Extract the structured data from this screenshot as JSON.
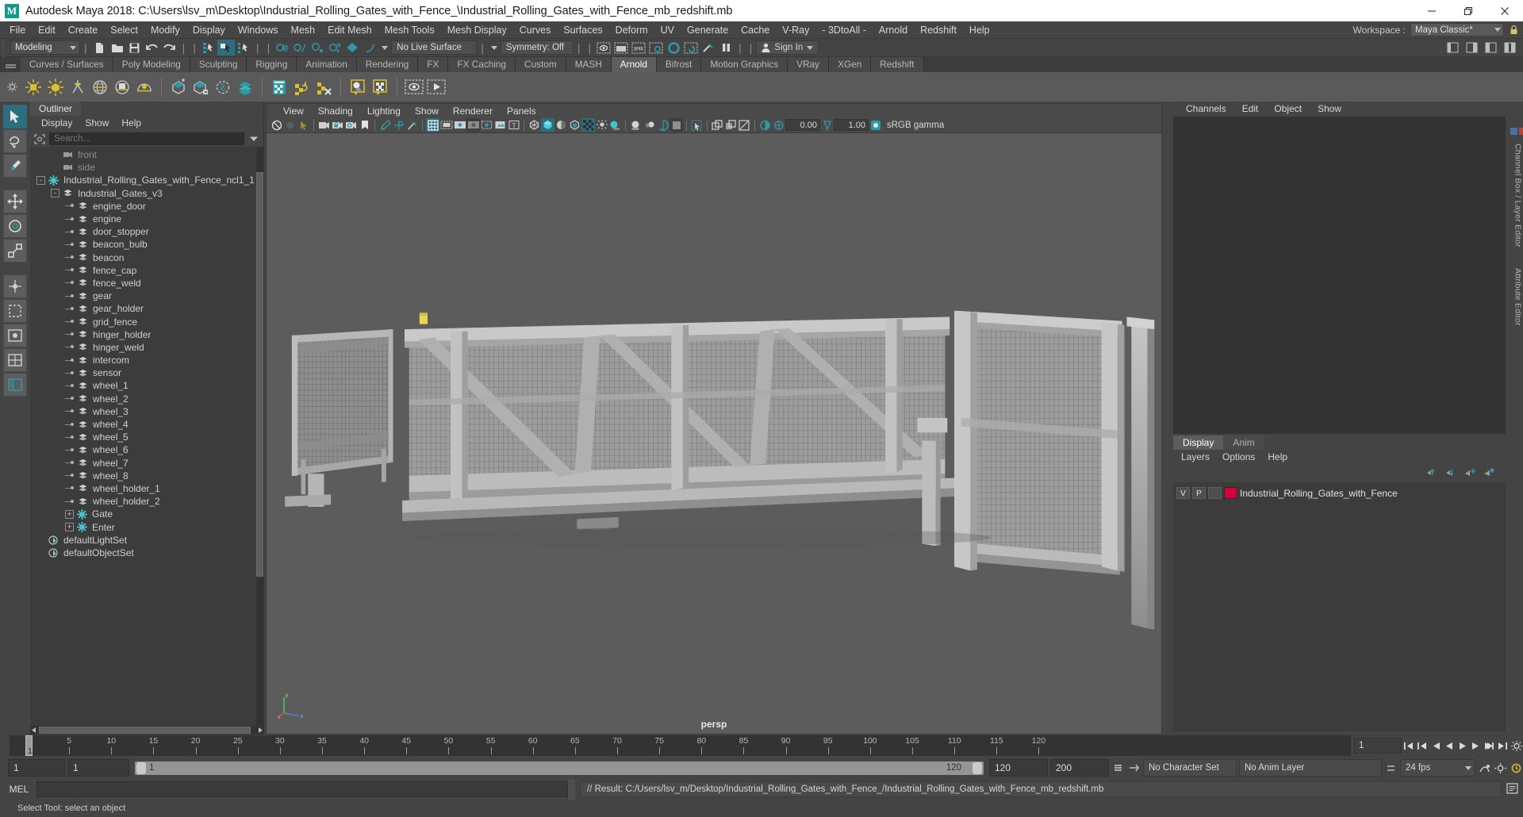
{
  "window": {
    "title": "Autodesk Maya 2018: C:\\Users\\lsv_m\\Desktop\\Industrial_Rolling_Gates_with_Fence_\\Industrial_Rolling_Gates_with_Fence_mb_redshift.mb",
    "logo": "M",
    "minimize": "minimize-icon",
    "restore": "restore-icon",
    "close": "close-icon"
  },
  "menubar": {
    "items": [
      "File",
      "Edit",
      "Create",
      "Select",
      "Modify",
      "Display",
      "Windows",
      "Mesh",
      "Edit Mesh",
      "Mesh Tools",
      "Mesh Display",
      "Curves",
      "Surfaces",
      "Deform",
      "UV",
      "Generate",
      "Cache",
      "V-Ray",
      "- 3DtoAll -",
      "Arnold",
      "Redshift",
      "Help"
    ],
    "workspace_label": "Workspace :",
    "workspace_value": "Maya Classic*"
  },
  "statusline": {
    "mode": "Modeling",
    "live_surface": "No Live Surface",
    "symmetry": "Symmetry: Off",
    "signin": "Sign In"
  },
  "shelf": {
    "tabs": [
      "Curves / Surfaces",
      "Poly Modeling",
      "Sculpting",
      "Rigging",
      "Animation",
      "Rendering",
      "FX",
      "FX Caching",
      "Custom",
      "MASH",
      "Arnold",
      "Bifrost",
      "Motion Graphics",
      "VRay",
      "XGen",
      "Redshift"
    ],
    "active_tab": "Arnold"
  },
  "outliner": {
    "tab": "Outliner",
    "menus": [
      "Display",
      "Show",
      "Help"
    ],
    "search_placeholder": "Search...",
    "items": [
      {
        "label": "front",
        "depth": 2,
        "icon": "camera-icon",
        "dim": true,
        "expander": null
      },
      {
        "label": "side",
        "depth": 2,
        "icon": "camera-icon",
        "dim": true,
        "expander": null
      },
      {
        "label": "Industrial_Rolling_Gates_with_Fence_ncl1_1",
        "depth": 1,
        "icon": "transform-icon",
        "dim": false,
        "expander": "-"
      },
      {
        "label": "Industrial_Gates_v3",
        "depth": 2,
        "icon": "mesh-icon",
        "dim": false,
        "expander": "-"
      },
      {
        "label": "engine_door",
        "depth": 3,
        "icon": "mesh-icon",
        "dim": false,
        "expander": null
      },
      {
        "label": "engine",
        "depth": 3,
        "icon": "mesh-icon",
        "dim": false,
        "expander": null
      },
      {
        "label": "door_stopper",
        "depth": 3,
        "icon": "mesh-icon",
        "dim": false,
        "expander": null
      },
      {
        "label": "beacon_bulb",
        "depth": 3,
        "icon": "mesh-icon",
        "dim": false,
        "expander": null
      },
      {
        "label": "beacon",
        "depth": 3,
        "icon": "mesh-icon",
        "dim": false,
        "expander": null
      },
      {
        "label": "fence_cap",
        "depth": 3,
        "icon": "mesh-icon",
        "dim": false,
        "expander": null
      },
      {
        "label": "fence_weld",
        "depth": 3,
        "icon": "mesh-icon",
        "dim": false,
        "expander": null
      },
      {
        "label": "gear",
        "depth": 3,
        "icon": "mesh-icon",
        "dim": false,
        "expander": null
      },
      {
        "label": "gear_holder",
        "depth": 3,
        "icon": "mesh-icon",
        "dim": false,
        "expander": null
      },
      {
        "label": "grid_fence",
        "depth": 3,
        "icon": "mesh-icon",
        "dim": false,
        "expander": null
      },
      {
        "label": "hinger_holder",
        "depth": 3,
        "icon": "mesh-icon",
        "dim": false,
        "expander": null
      },
      {
        "label": "hinger_weld",
        "depth": 3,
        "icon": "mesh-icon",
        "dim": false,
        "expander": null
      },
      {
        "label": "intercom",
        "depth": 3,
        "icon": "mesh-icon",
        "dim": false,
        "expander": null
      },
      {
        "label": "sensor",
        "depth": 3,
        "icon": "mesh-icon",
        "dim": false,
        "expander": null
      },
      {
        "label": "wheel_1",
        "depth": 3,
        "icon": "mesh-icon",
        "dim": false,
        "expander": null
      },
      {
        "label": "wheel_2",
        "depth": 3,
        "icon": "mesh-icon",
        "dim": false,
        "expander": null
      },
      {
        "label": "wheel_3",
        "depth": 3,
        "icon": "mesh-icon",
        "dim": false,
        "expander": null
      },
      {
        "label": "wheel_4",
        "depth": 3,
        "icon": "mesh-icon",
        "dim": false,
        "expander": null
      },
      {
        "label": "wheel_5",
        "depth": 3,
        "icon": "mesh-icon",
        "dim": false,
        "expander": null
      },
      {
        "label": "wheel_6",
        "depth": 3,
        "icon": "mesh-icon",
        "dim": false,
        "expander": null
      },
      {
        "label": "wheel_7",
        "depth": 3,
        "icon": "mesh-icon",
        "dim": false,
        "expander": null
      },
      {
        "label": "wheel_8",
        "depth": 3,
        "icon": "mesh-icon",
        "dim": false,
        "expander": null
      },
      {
        "label": "wheel_holder_1",
        "depth": 3,
        "icon": "mesh-icon",
        "dim": false,
        "expander": null
      },
      {
        "label": "wheel_holder_2",
        "depth": 3,
        "icon": "mesh-icon",
        "dim": false,
        "expander": null
      },
      {
        "label": "Gate",
        "depth": 3,
        "icon": "transform-icon",
        "dim": false,
        "expander": "+"
      },
      {
        "label": "Enter",
        "depth": 3,
        "icon": "transform-icon",
        "dim": false,
        "expander": "+"
      },
      {
        "label": "defaultLightSet",
        "depth": 1,
        "icon": "set-icon",
        "dim": false,
        "expander": null
      },
      {
        "label": "defaultObjectSet",
        "depth": 1,
        "icon": "set-icon",
        "dim": false,
        "expander": null
      }
    ]
  },
  "viewport": {
    "menus": [
      "View",
      "Shading",
      "Lighting",
      "Show",
      "Renderer",
      "Panels"
    ],
    "exposure": "0.00",
    "gain": "1.00",
    "gamma_label": "sRGB gamma",
    "camera_label": "persp",
    "axis": {
      "x": "x",
      "y": "y",
      "z": "z"
    }
  },
  "channelbox": {
    "menus": [
      "Channels",
      "Edit",
      "Object",
      "Show"
    ],
    "side_label": "Channel Box / Layer Editor",
    "attr_label": "Attribute Editor"
  },
  "layers": {
    "tabs": [
      "Display",
      "Anim"
    ],
    "active_tab": "Display",
    "menus": [
      "Layers",
      "Options",
      "Help"
    ],
    "rows": [
      {
        "v": "V",
        "p": "P",
        "swatch": "#d1003c",
        "name": "Industrial_Rolling_Gates_with_Fence"
      }
    ]
  },
  "timeline": {
    "current_frame": "1",
    "ticks": [
      5,
      10,
      15,
      20,
      25,
      30,
      35,
      40,
      45,
      50,
      55,
      60,
      65,
      70,
      75,
      80,
      85,
      90,
      95,
      100,
      105,
      110,
      115,
      120
    ],
    "range_start": "1",
    "range_start_2": "1",
    "slider_start": "1",
    "slider_end": "120",
    "anim_start": "120",
    "anim_end": "200",
    "current_field": "1",
    "character_set": "No Character Set",
    "anim_layer": "No Anim Layer",
    "fps": "24 fps"
  },
  "command": {
    "mel_label": "MEL",
    "mel_value": "",
    "result": "// Result: C:/Users/lsv_m/Desktop/Industrial_Rolling_Gates_with_Fence_/Industrial_Rolling_Gates_with_Fence_mb_redshift.mb"
  },
  "helpline": {
    "text": "Select Tool: select an object"
  },
  "colors": {
    "accent_teal": "#2d9aa8",
    "shelf_yellow": "#d9c030",
    "layer_red": "#d1003c",
    "panel_bg": "#444444",
    "viewport_bg": "#5c5c5c"
  }
}
